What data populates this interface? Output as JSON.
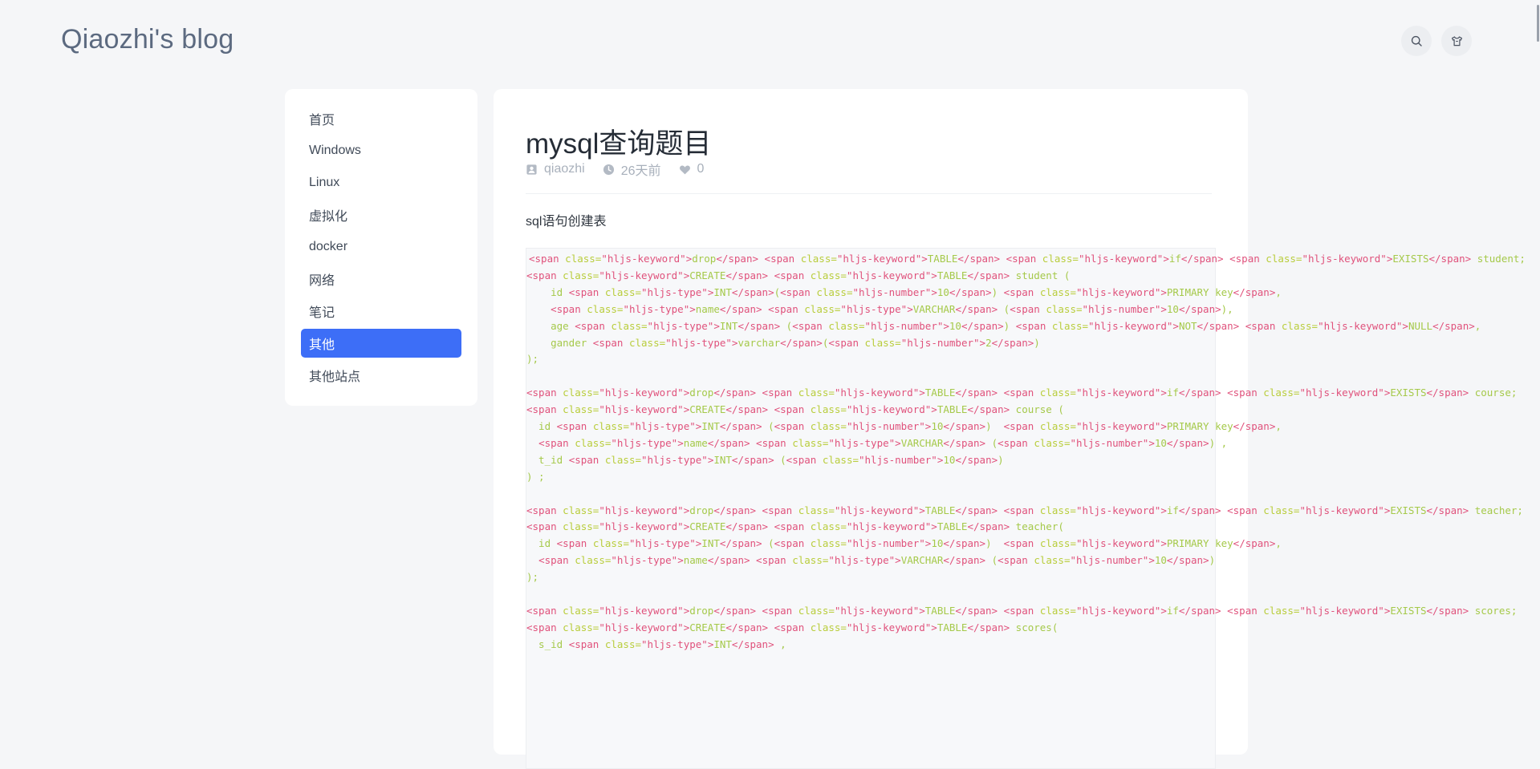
{
  "header": {
    "site_title": "Qiaozhi's blog",
    "buttons": [
      {
        "name": "search-icon"
      },
      {
        "name": "shirt-icon"
      }
    ]
  },
  "sidebar": {
    "items": [
      {
        "label": "首页",
        "active": false
      },
      {
        "label": "Windows",
        "active": false
      },
      {
        "label": "Linux",
        "active": false
      },
      {
        "label": "虚拟化",
        "active": false
      },
      {
        "label": "docker",
        "active": false
      },
      {
        "label": "网络",
        "active": false
      },
      {
        "label": "笔记",
        "active": false
      },
      {
        "label": "其他",
        "active": true
      },
      {
        "label": "其他站点",
        "active": false
      }
    ]
  },
  "post": {
    "title": "mysql查询题目",
    "meta": {
      "author": "qiaozhi",
      "time": "26天前",
      "likes": "0"
    },
    "section_heading": "sql语句创建表",
    "code_lines": [
      "<span class=\"hljs-keyword\">drop</span> <span class=\"hljs-keyword\">TABLE</span> <span class=\"hljs-keyword\">if</span> <span class=\"hljs-keyword\">EXISTS</span> student;",
      "<span class=\"hljs-keyword\">CREATE</span> <span class=\"hljs-keyword\">TABLE</span> student (",
      "    id <span class=\"hljs-type\">INT</span>(<span class=\"hljs-number\">10</span>) <span class=\"hljs-keyword\">PRIMARY key</span>,",
      "    <span class=\"hljs-type\">name</span> <span class=\"hljs-type\">VARCHAR</span> (<span class=\"hljs-number\">10</span>),",
      "    age <span class=\"hljs-type\">INT</span> (<span class=\"hljs-number\">10</span>) <span class=\"hljs-keyword\">NOT</span> <span class=\"hljs-keyword\">NULL</span>,",
      "    gander <span class=\"hljs-type\">varchar</span>(<span class=\"hljs-number\">2</span>)",
      ");",
      "",
      "<span class=\"hljs-keyword\">drop</span> <span class=\"hljs-keyword\">TABLE</span> <span class=\"hljs-keyword\">if</span> <span class=\"hljs-keyword\">EXISTS</span> course;",
      "<span class=\"hljs-keyword\">CREATE</span> <span class=\"hljs-keyword\">TABLE</span> course (",
      "  id <span class=\"hljs-type\">INT</span> (<span class=\"hljs-number\">10</span>)  <span class=\"hljs-keyword\">PRIMARY key</span>,",
      "  <span class=\"hljs-type\">name</span> <span class=\"hljs-type\">VARCHAR</span> (<span class=\"hljs-number\">10</span>) ,",
      "  t_id <span class=\"hljs-type\">INT</span> (<span class=\"hljs-number\">10</span>)",
      ") ;",
      "",
      "<span class=\"hljs-keyword\">drop</span> <span class=\"hljs-keyword\">TABLE</span> <span class=\"hljs-keyword\">if</span> <span class=\"hljs-keyword\">EXISTS</span> teacher;",
      "<span class=\"hljs-keyword\">CREATE</span> <span class=\"hljs-keyword\">TABLE</span> teacher(",
      "  id <span class=\"hljs-type\">INT</span> (<span class=\"hljs-number\">10</span>)  <span class=\"hljs-keyword\">PRIMARY key</span>,",
      "  <span class=\"hljs-type\">name</span> <span class=\"hljs-type\">VARCHAR</span> (<span class=\"hljs-number\">10</span>)",
      ");",
      "",
      "<span class=\"hljs-keyword\">drop</span> <span class=\"hljs-keyword\">TABLE</span> <span class=\"hljs-keyword\">if</span> <span class=\"hljs-keyword\">EXISTS</span> scores;",
      "<span class=\"hljs-keyword\">CREATE</span> <span class=\"hljs-keyword\">TABLE</span> scores(",
      "  s_id <span class=\"hljs-type\">INT</span> ,"
    ]
  },
  "colors": {
    "accent": "#3d6ef7",
    "page_bg": "#f5f6f8",
    "card_bg": "#ffffff",
    "code_tag": "#e0527c",
    "code_attr": "#b9cd3c",
    "code_text": "#a5c94a",
    "code_keyword": "#5db542"
  }
}
